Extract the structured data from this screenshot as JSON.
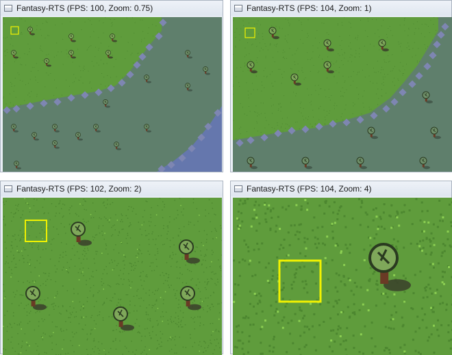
{
  "windows": [
    {
      "title": "Fantasy-RTS (FPS: 100, Zoom: 0.75)",
      "zoom": 0.75
    },
    {
      "title": "Fantasy-RTS (FPS: 104, Zoom: 1)",
      "zoom": 1
    },
    {
      "title": "Fantasy-RTS (FPS: 102, Zoom: 2)",
      "zoom": 2
    },
    {
      "title": "Fantasy-RTS (FPS: 104, Zoom: 4)",
      "zoom": 4
    }
  ],
  "colors": {
    "grass": "#5f9c3c",
    "grass_dark": "#4d8730",
    "grass_light": "#8ccf52",
    "water": "#5f7f6c",
    "water_edge": "#7e86b2",
    "deep_water": "#6577ad",
    "tree_top": "#7fa85a",
    "tree_outline": "#2a3a20",
    "trunk": "#6a3a25",
    "shadow": "#3a3f2a",
    "cursor": "#f2f200"
  },
  "icons": {
    "window": "app-window-icon",
    "tree": "tree-icon",
    "cursor": "selection-cursor-icon"
  }
}
